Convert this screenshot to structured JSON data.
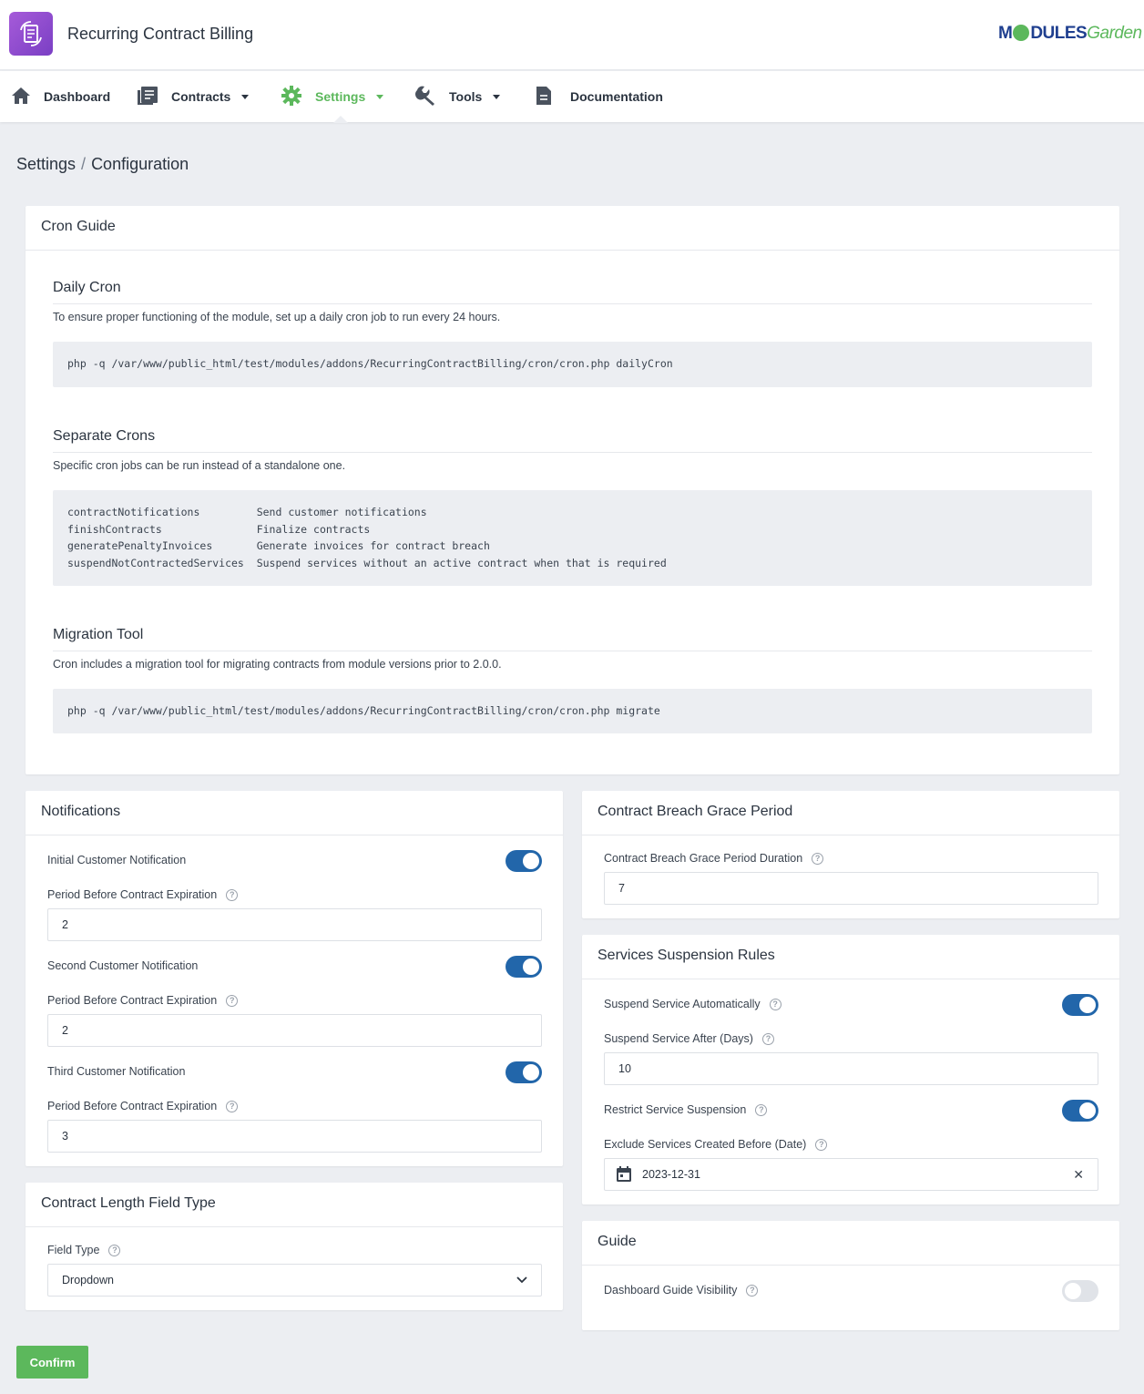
{
  "app": {
    "title": "Recurring Contract Billing",
    "logo_left": "M",
    "logo_mid": "DULES",
    "logo_right": "Garden"
  },
  "nav": {
    "dashboard": "Dashboard",
    "contracts": "Contracts",
    "settings": "Settings",
    "tools": "Tools",
    "documentation": "Documentation"
  },
  "breadcrumb": {
    "parent": "Settings",
    "separator": "/",
    "current": "Configuration"
  },
  "cron_guide": {
    "title": "Cron Guide",
    "daily": {
      "heading": "Daily Cron",
      "text": "To ensure proper functioning of the module, set up a daily cron job to run every 24 hours.",
      "command": "php -q /var/www/public_html/test/modules/addons/RecurringContractBilling/cron/cron.php dailyCron"
    },
    "separate": {
      "heading": "Separate Crons",
      "text": "Specific cron jobs can be run instead of a standalone one.",
      "lines": [
        "contractNotifications         Send customer notifications",
        "finishContracts               Finalize contracts",
        "generatePenaltyInvoices       Generate invoices for contract breach",
        "suspendNotContractedServices  Suspend services without an active contract when that is required"
      ]
    },
    "migration": {
      "heading": "Migration Tool",
      "text": "Cron includes a migration tool for migrating contracts from module versions prior to 2.0.0.",
      "command": "php -q /var/www/public_html/test/modules/addons/RecurringContractBilling/cron/cron.php migrate"
    }
  },
  "notifications": {
    "title": "Notifications",
    "initial_label": "Initial Customer Notification",
    "initial_on": true,
    "period1_label": "Period Before Contract Expiration",
    "period1_value": "2",
    "second_label": "Second Customer Notification",
    "second_on": true,
    "period2_label": "Period Before Contract Expiration",
    "period2_value": "2",
    "third_label": "Third Customer Notification",
    "third_on": true,
    "period3_label": "Period Before Contract Expiration",
    "period3_value": "3"
  },
  "length_field": {
    "title": "Contract Length Field Type",
    "label": "Field Type",
    "value": "Dropdown"
  },
  "grace": {
    "title": "Contract Breach Grace Period",
    "label": "Contract Breach Grace Period Duration",
    "value": "7"
  },
  "suspension": {
    "title": "Services Suspension Rules",
    "auto_label": "Suspend Service Automatically",
    "auto_on": true,
    "after_label": "Suspend Service After (Days)",
    "after_value": "10",
    "restrict_label": "Restrict Service Suspension",
    "restrict_on": true,
    "exclude_label": "Exclude Services Created Before (Date)",
    "exclude_value": "2023-12-31"
  },
  "guide": {
    "title": "Guide",
    "label": "Dashboard Guide Visibility",
    "visible": false
  },
  "confirm_label": "Confirm",
  "help_glyph": "?",
  "clear_glyph": "✕",
  "colors": {
    "accent": "#5cb85c",
    "toggle_on": "#2266aa",
    "brand": "#1f3f8f",
    "app_icon": "#9b51e0"
  }
}
